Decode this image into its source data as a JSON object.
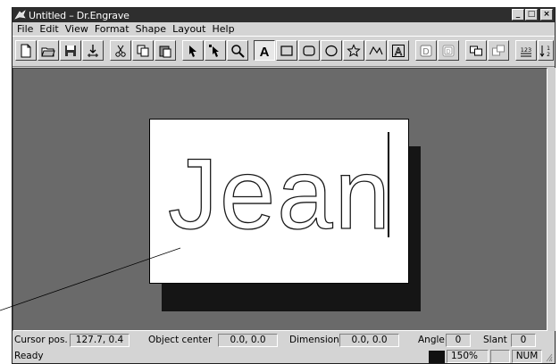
{
  "window": {
    "title": "Untitled – Dr.Engrave"
  },
  "window_controls": {
    "minimize": "_",
    "maximize": "□",
    "close": "×"
  },
  "menu": [
    "File",
    "Edit",
    "View",
    "Format",
    "Shape",
    "Layout",
    "Help"
  ],
  "toolbar": {
    "buttons": [
      "new-file",
      "open-file",
      "save-file",
      "import",
      "cut",
      "copy",
      "paste",
      "select-arrow",
      "node-edit",
      "zoom",
      "text-tool",
      "rectangle",
      "rounded-rectangle",
      "ellipse",
      "star",
      "polyline",
      "text-frame",
      "front-tool",
      "back-tool",
      "group",
      "ungroup",
      "number-text",
      "sort-numbers"
    ],
    "active": "text-tool",
    "number_label": "123"
  },
  "canvas": {
    "text": "Jean"
  },
  "status": {
    "cursor_label": "Cursor pos.",
    "cursor_value": "127.7, 0.4",
    "center_label": "Object center",
    "center_value": "0.0, 0.0",
    "dimension_label": "Dimension",
    "dimension_value": "0.0, 0.0",
    "angle_label": "Angle",
    "angle_value": "0",
    "slant_label": "Slant",
    "slant_value": "0",
    "ready": "Ready",
    "zoom": "150%",
    "num": "NUM"
  }
}
